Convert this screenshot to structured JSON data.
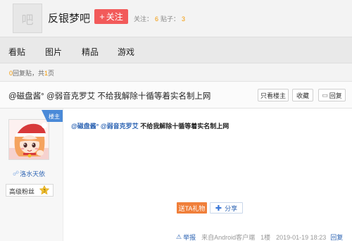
{
  "header": {
    "forum_avatar_glyph": "吧",
    "forum_name": "反银梦吧",
    "follow_button": "关注",
    "follow_plus": "+",
    "stats": {
      "follow_label": "关注：",
      "follow_count": "6",
      "posts_label": "贴子：",
      "posts_count": "3"
    }
  },
  "nav": {
    "items": [
      "看贴",
      "图片",
      "精品",
      "游戏"
    ]
  },
  "pager": {
    "reply_count": "0",
    "text_mid": "回复贴，共",
    "page_count": "1",
    "text_end": "页"
  },
  "thread": {
    "title": "@磁盘酱° @弱音克罗艾 不给我解除十循等着实名制上网",
    "buttons": {
      "only_author": "只看楼主",
      "favorite": "收藏",
      "reply": "回复"
    }
  },
  "post": {
    "badge": "楼主",
    "username": "洛水天依",
    "rank_title": "高级粉丝",
    "rank_level": "3",
    "content": {
      "mention1": "@磁盘酱°",
      "mention2": "@弱音克罗艾",
      "text": "不给我解除十循等着实名制上网"
    },
    "gift_button": "送TA礼物",
    "share_button": "分享",
    "footer": {
      "report": "举报",
      "source": "来自Android客户端",
      "floor": "1楼",
      "timestamp": "2019-01-19 18:23",
      "reply": "回复"
    }
  },
  "colors": {
    "accent_red": "#f25a5a",
    "accent_orange": "#f39800",
    "link_blue": "#2d64b3",
    "badge_blue": "#4a8ad8"
  }
}
